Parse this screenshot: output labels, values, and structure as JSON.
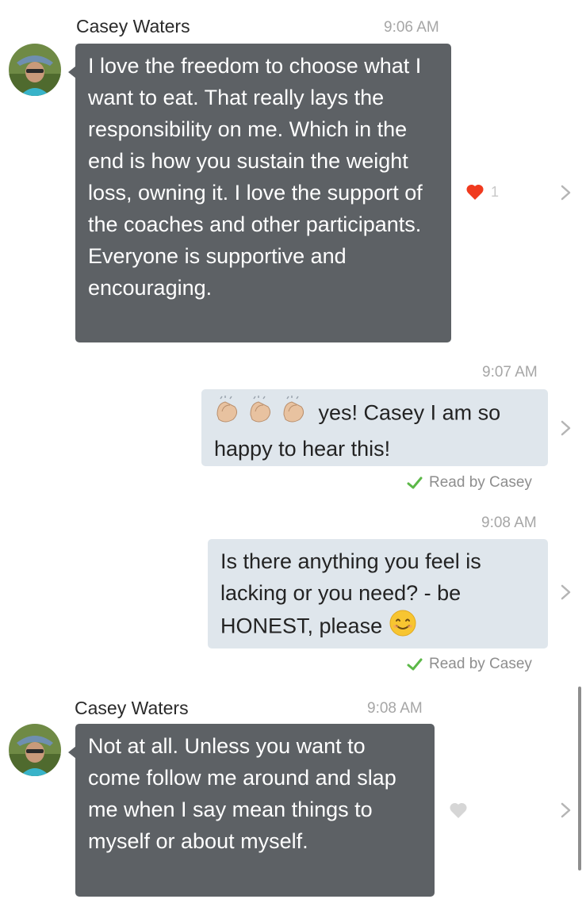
{
  "messages": [
    {
      "sender": "Casey Waters",
      "time": "9:06 AM",
      "text": "I love the freedom to choose what I want to eat. That really lays the responsibility on me. Which in the end is how you sustain the weight loss, owning it. I love the support of the coaches and other participants. Everyone is supportive and encouraging.",
      "likes": "1"
    },
    {
      "time": "9:07 AM",
      "emoji": "clapping-hands x3",
      "text": "yes! Casey I am so happy to hear this!",
      "read": "Read by Casey"
    },
    {
      "time": "9:08 AM",
      "text": "Is there anything you feel is lacking or you need? - be HONEST, please",
      "emoji": "smiling-face",
      "read": "Read by Casey"
    },
    {
      "sender": "Casey Waters",
      "time": "9:08 AM",
      "text": "Not at all. Unless you want to come follow me around and slap me when I say mean things to myself or about myself."
    }
  ],
  "colors": {
    "incoming_bubble": "#5d6165",
    "outgoing_bubble": "#dfe6ec",
    "heart_liked": "#f03a1e",
    "heart_unliked": "#d6d6d6",
    "read_check": "#5cb848"
  }
}
